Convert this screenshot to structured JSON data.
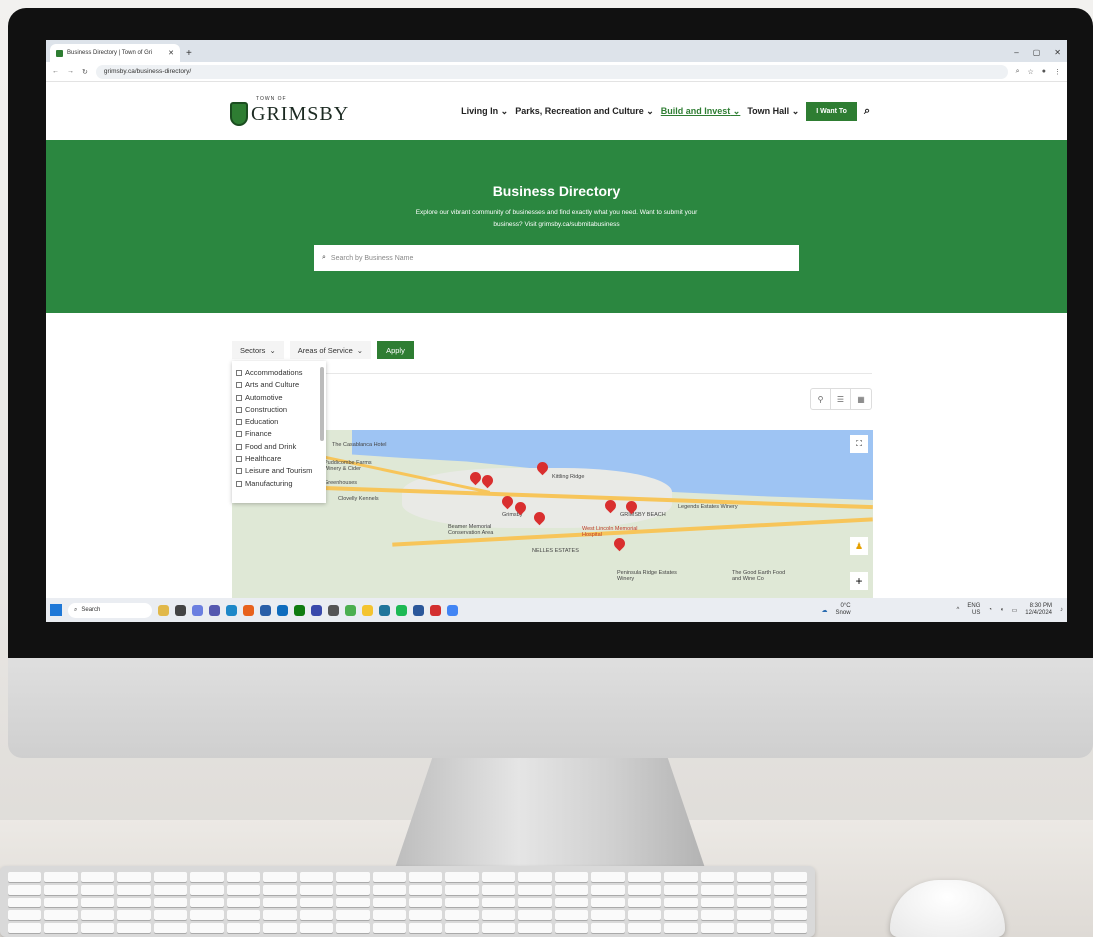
{
  "browser": {
    "tab_title": "Business Directory | Town of Gri",
    "url": "grimsby.ca/business-directory/",
    "window_controls": [
      "–",
      "▢",
      "✕"
    ]
  },
  "site": {
    "logo_top": "TOWN OF",
    "logo_name": "GRIMSBY",
    "nav": [
      {
        "label": "Living In"
      },
      {
        "label": "Parks, Recreation and Culture"
      },
      {
        "label": "Build and Invest"
      },
      {
        "label": "Town Hall"
      }
    ],
    "cta": "I Want To"
  },
  "hero": {
    "title": "Business Directory",
    "desc": "Explore our vibrant community of businesses and find exactly what you need. Want to submit your business? Visit grimsby.ca/submitabusiness",
    "search_placeholder": "Search by Business Name"
  },
  "filters": {
    "sectors": "Sectors",
    "areas": "Areas of Service",
    "apply": "Apply"
  },
  "sectors_options": [
    "Accommodations",
    "Arts and Culture",
    "Automotive",
    "Construction",
    "Education",
    "Finance",
    "Food and Drink",
    "Healthcare",
    "Leisure and Tourism",
    "Manufacturing"
  ],
  "map": {
    "labels": {
      "casablanca": "The Casablanca Hotel",
      "puddicombe": "Puddicombe Farms Winery & Cider",
      "greenhouses": "Greenhouses",
      "clovelly": "Clovelly Kennels",
      "beamer": "Beamer Memorial Conservation Area",
      "westlincoln": "West Lincoln Memorial Hospital",
      "nelles": "NELLES ESTATES",
      "grimsby": "Grimsby",
      "beach": "GRIMSBY BEACH",
      "peninsula": "Peninsula Ridge Estates Winery",
      "goodearth": "The Good Earth Food and Wine Co",
      "kittling": "Kittling Ridge",
      "legends": "Legends Estates Winery"
    }
  },
  "taskbar": {
    "search": "Search",
    "weather_temp": "0°C",
    "weather_desc": "Snow",
    "lang": "ENG",
    "region": "US",
    "time": "8:30 PM",
    "date": "12/4/2024"
  }
}
